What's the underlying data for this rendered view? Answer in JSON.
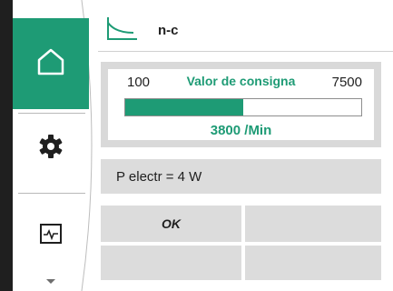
{
  "header": {
    "mode_icon": "control-curve-icon",
    "mode_label": "n-c"
  },
  "sidebar": {
    "items": [
      {
        "name": "home",
        "icon": "home-icon",
        "active": true
      },
      {
        "name": "settings",
        "icon": "gear-icon",
        "active": false
      },
      {
        "name": "diagnostics",
        "icon": "pulse-monitor-icon",
        "active": false
      },
      {
        "name": "more",
        "icon": "chevron-down-icon",
        "active": false
      }
    ]
  },
  "setpoint": {
    "min": "100",
    "title": "Valor de consigna",
    "max": "7500",
    "value": "3800 /Min",
    "fill_fraction": 0.5
  },
  "power": {
    "text": "P electr = 4 W"
  },
  "soft_buttons": {
    "ok_label": "OK"
  },
  "colors": {
    "accent": "#1e9b75",
    "rail": "#1f1f1f",
    "panel": "#dcdcdc"
  }
}
